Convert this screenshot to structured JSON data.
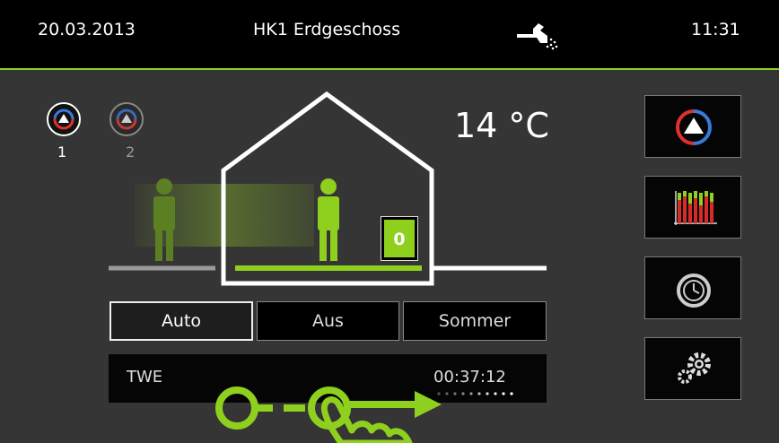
{
  "header": {
    "date": "20.03.2013",
    "title": "HK1 Erdgeschoss",
    "time": "11:31",
    "status_icon": "faucet-water-icon"
  },
  "circuits": [
    {
      "label": "1",
      "active": true
    },
    {
      "label": "2",
      "active": false
    }
  ],
  "temperature": "14 °C",
  "room_counter": "0",
  "modes": [
    {
      "label": "Auto",
      "active": true
    },
    {
      "label": "Aus",
      "active": false
    },
    {
      "label": "Sommer",
      "active": false
    }
  ],
  "twe": {
    "label": "TWE",
    "timer": "00:37:12"
  },
  "side_buttons": [
    "circuit-mode-icon",
    "schedule-chart-icon",
    "clock-icon",
    "settings-gears-icon"
  ],
  "colors": {
    "accent_green": "#8fcf1e",
    "background": "#353535",
    "topbar": "#000000"
  }
}
